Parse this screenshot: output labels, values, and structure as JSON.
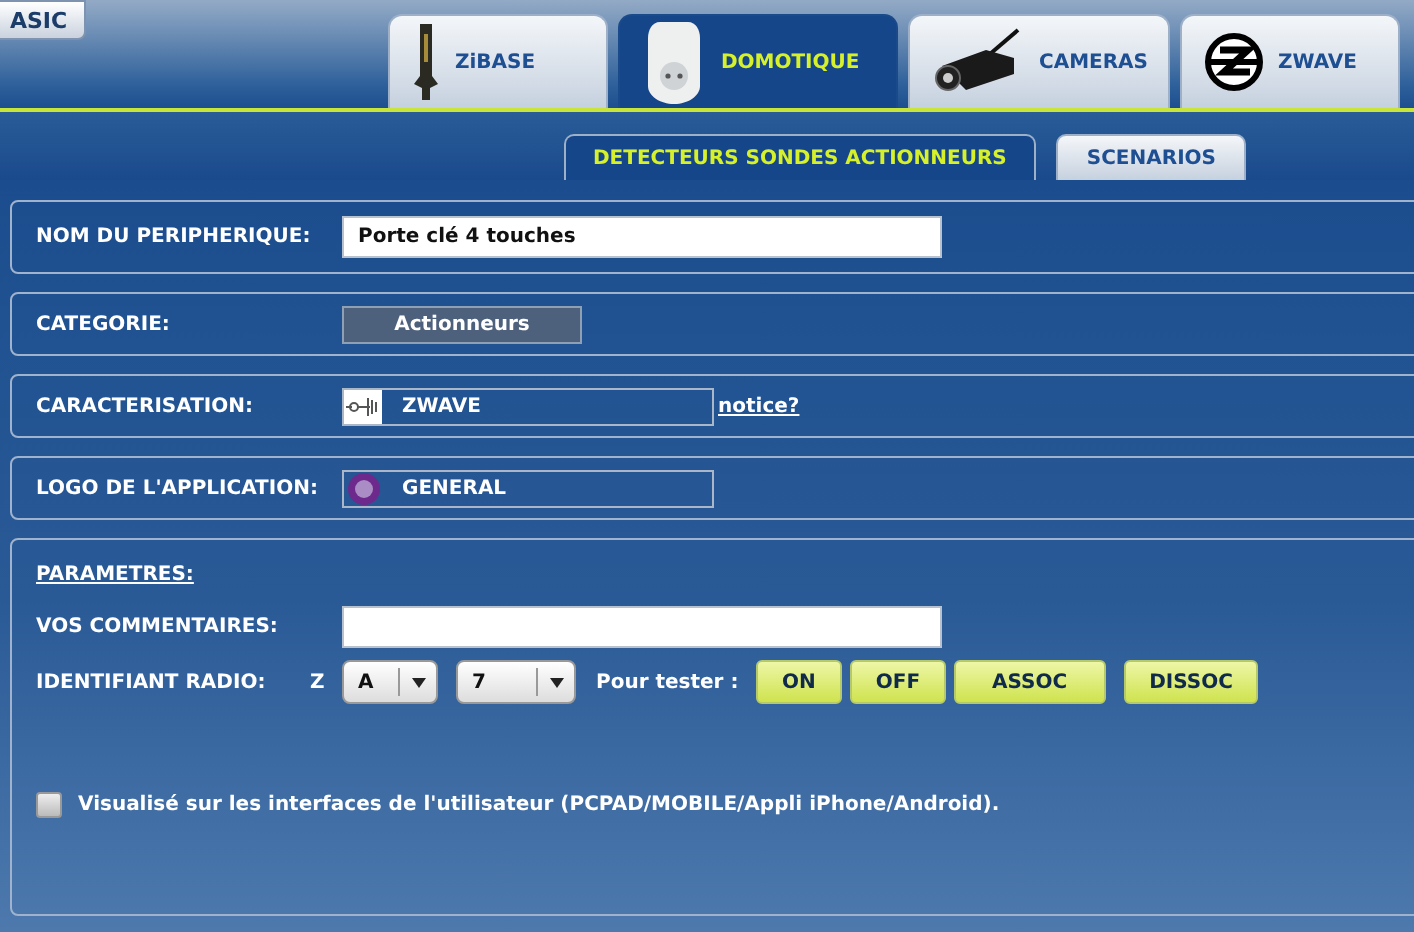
{
  "back_button": {
    "label": "ASIC"
  },
  "main_tabs": [
    {
      "label": "ZiBASE",
      "selected": false
    },
    {
      "label": "DOMOTIQUE",
      "selected": true
    },
    {
      "label": "CAMERAS",
      "selected": false
    },
    {
      "label": "ZWAVE",
      "selected": false
    }
  ],
  "sub_tabs": [
    {
      "label": "DETECTEURS SONDES ACTIONNEURS",
      "selected": true
    },
    {
      "label": "SCENARIOS",
      "selected": false
    }
  ],
  "form": {
    "name": {
      "label": "NOM DU PERIPHERIQUE:",
      "value": "Porte clé 4 touches"
    },
    "category": {
      "label": "CATEGORIE:",
      "value": "Actionneurs"
    },
    "characterization": {
      "label": "CARACTERISATION:",
      "value": "ZWAVE",
      "link": "notice?"
    },
    "logo": {
      "label": "LOGO DE L'APPLICATION:",
      "value": "GENERAL"
    },
    "parameters": {
      "title": "PARAMETRES:",
      "comments": {
        "label": "VOS COMMENTAIRES:"
      },
      "radio": {
        "label": "IDENTIFIANT RADIO:",
        "prefix": "Z",
        "house": "A",
        "unit": "7",
        "test_label": "Pour tester :",
        "buttons": [
          "ON",
          "OFF",
          "ASSOC",
          "DISSOC"
        ]
      },
      "visible": {
        "label": "Visualisé sur les interfaces de l'utilisateur (PCPAD/MOBILE/Appli iPhone/Android).",
        "checked": false
      }
    }
  }
}
